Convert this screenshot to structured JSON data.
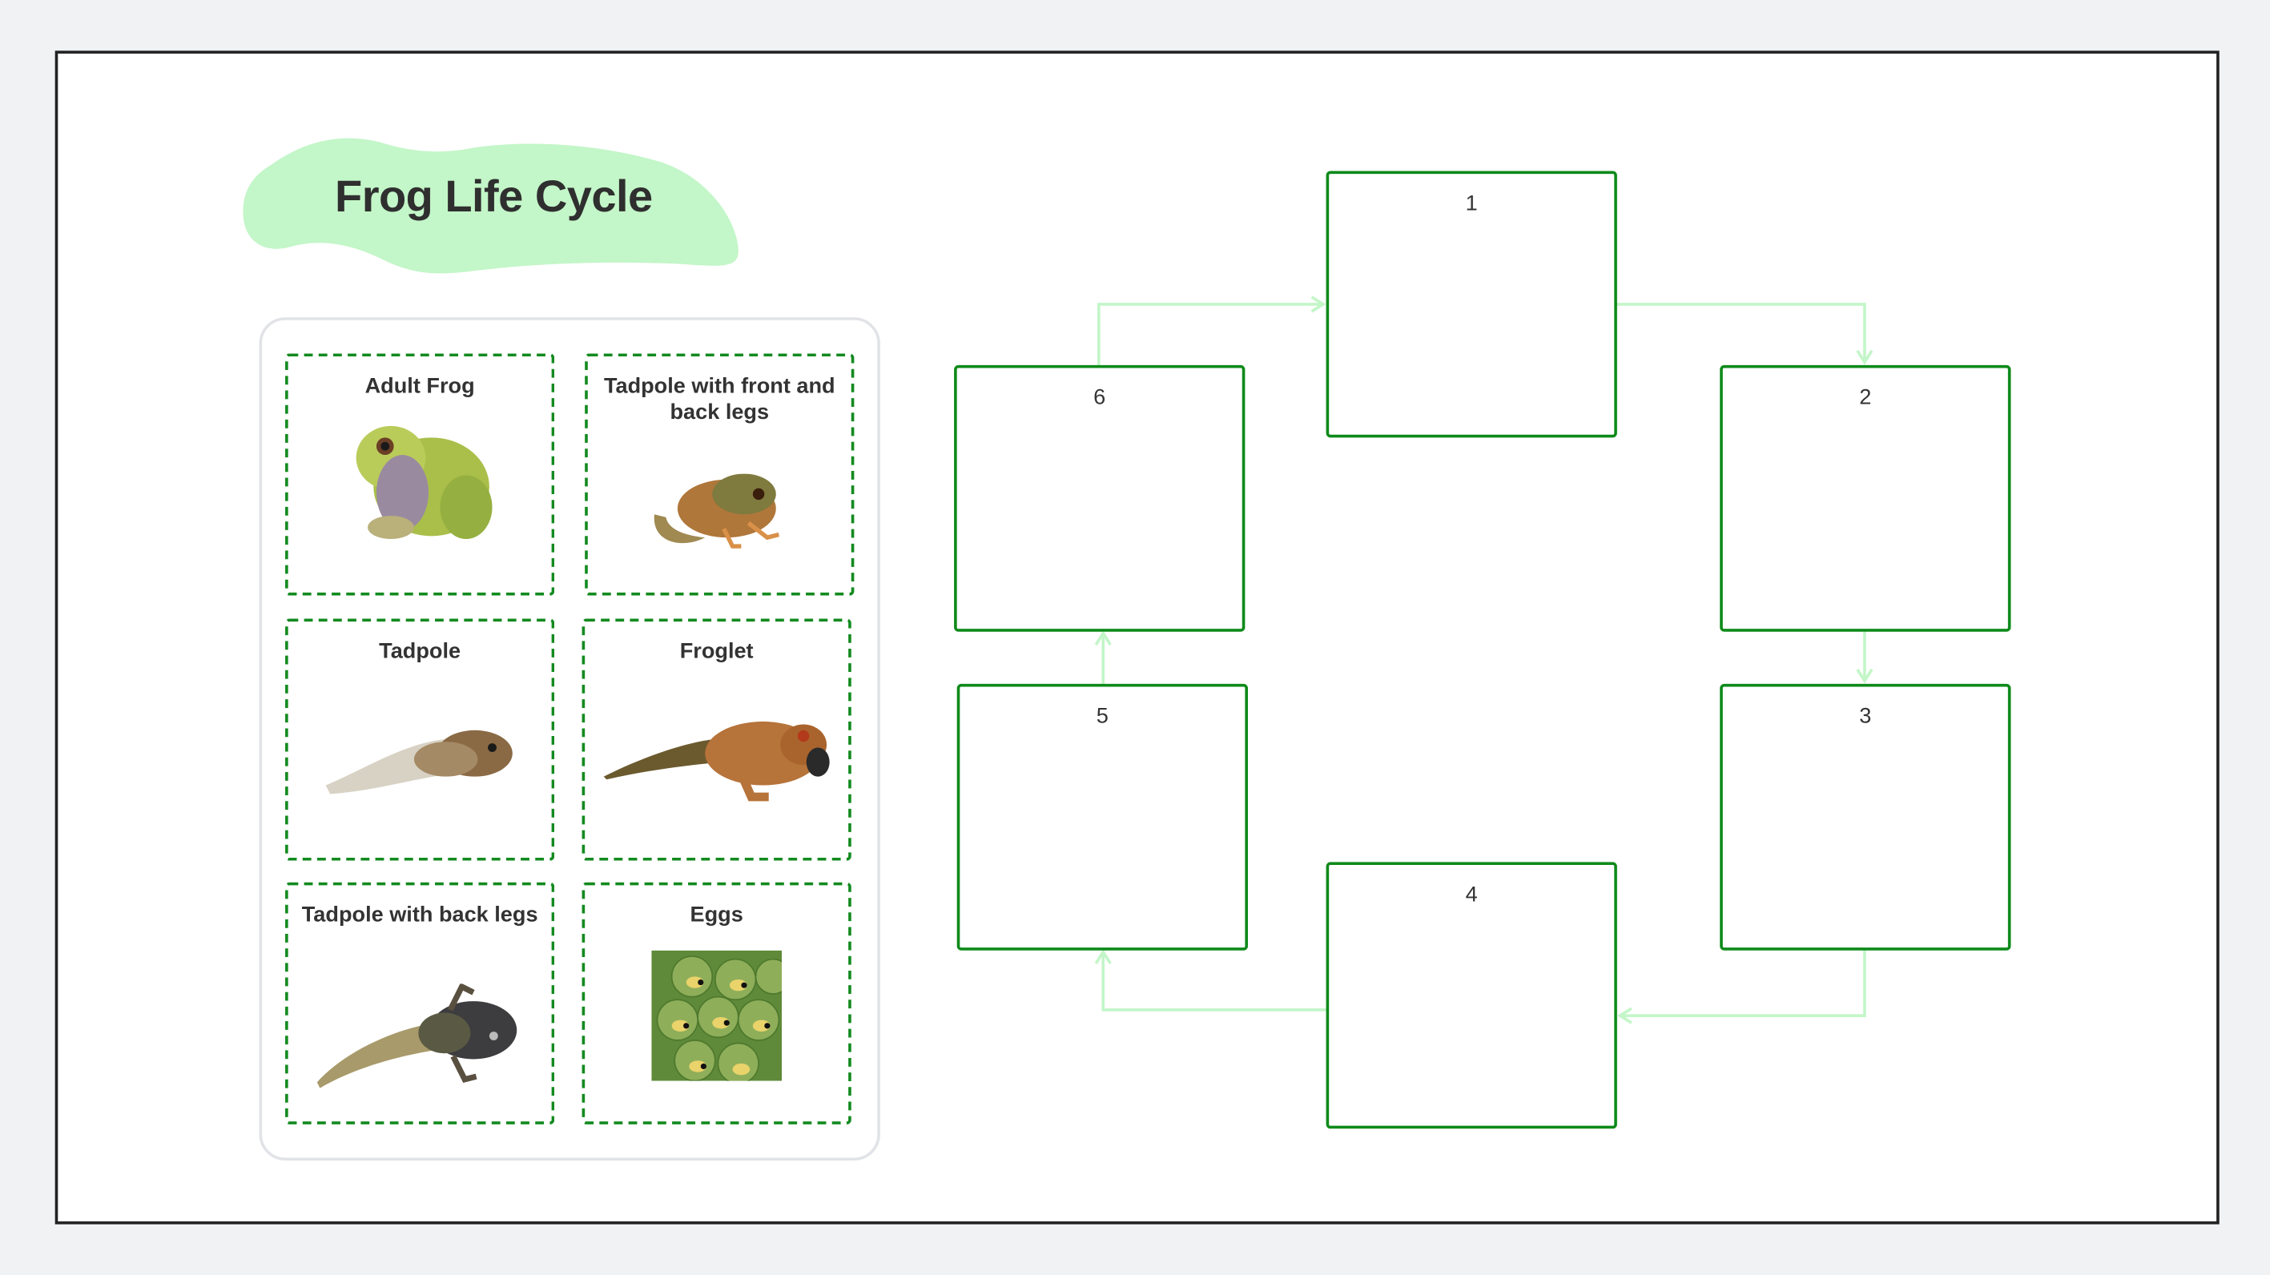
{
  "title": "Frog Life Cycle",
  "colors": {
    "title_blob": "#c3f6c8",
    "card_border": "#138a1f",
    "slot_border": "#0e8a1a",
    "arrow": "#c3f6c8",
    "frame_border": "#222222",
    "page_bg": "#f1f2f4"
  },
  "cards": [
    {
      "label": "Adult Frog",
      "image": "adult-frog-photo"
    },
    {
      "label": "Tadpole with front and back legs",
      "image": "tadpole-front-back-legs-photo"
    },
    {
      "label": "Tadpole",
      "image": "tadpole-photo"
    },
    {
      "label": "Froglet",
      "image": "froglet-photo"
    },
    {
      "label": "Tadpole with back legs",
      "image": "tadpole-back-legs-photo"
    },
    {
      "label": "Eggs",
      "image": "eggs-photo"
    }
  ],
  "slots": [
    {
      "number": "1"
    },
    {
      "number": "2"
    },
    {
      "number": "3"
    },
    {
      "number": "4"
    },
    {
      "number": "5"
    },
    {
      "number": "6"
    }
  ],
  "cycle_order": [
    "1",
    "2",
    "3",
    "4",
    "5",
    "6",
    "1"
  ]
}
